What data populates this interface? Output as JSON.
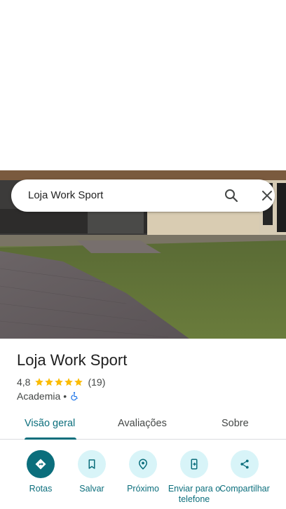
{
  "search": {
    "query": "Loja Work Sport"
  },
  "place": {
    "name": "Loja Work Sport",
    "rating": "4,8",
    "reviews": "(19)",
    "stars": 5,
    "category": "Academia",
    "separator": "•"
  },
  "tabs": [
    {
      "label": "Visão geral",
      "active": true
    },
    {
      "label": "Avaliações",
      "active": false
    },
    {
      "label": "Sobre",
      "active": false
    }
  ],
  "actions": [
    {
      "label": "Rotas",
      "icon": "directions-icon"
    },
    {
      "label": "Salvar",
      "icon": "bookmark-icon"
    },
    {
      "label": "Próximo",
      "icon": "nearby-icon"
    },
    {
      "label": "Enviar para o telefone",
      "icon": "send-to-phone-icon"
    },
    {
      "label": "Compartilhar",
      "icon": "share-icon"
    }
  ],
  "colors": {
    "accent": "#0b6e7c",
    "action_bg": "#d8f4f8",
    "star": "#fbbc04",
    "wheelchair": "#1a73e8"
  }
}
